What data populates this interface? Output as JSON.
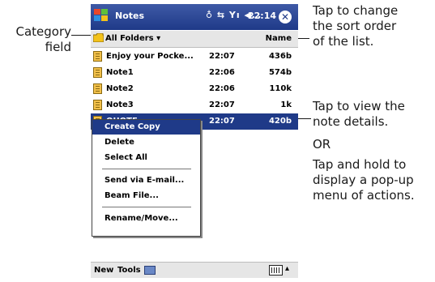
{
  "callouts": {
    "category": [
      "Category",
      "field"
    ],
    "sort": [
      "Tap to change",
      "the sort order",
      "of the list."
    ],
    "view": [
      "Tap to view the",
      "note details."
    ],
    "or": "OR",
    "hold": [
      "Tap and hold to",
      "display a pop-up",
      "menu of actions."
    ]
  },
  "titlebar": {
    "app_title": "Notes",
    "status_icons": "♁ ⇆ Yı ◀…",
    "time": "22:14",
    "close_icon": "✕"
  },
  "header": {
    "folder_label": "All Folders ▾",
    "sort_label": "Name"
  },
  "notes": [
    {
      "name": "Enjoy your Pocke...",
      "time": "22:07",
      "size": "436b"
    },
    {
      "name": "Note1",
      "time": "22:06",
      "size": "574b"
    },
    {
      "name": "Note2",
      "time": "22:06",
      "size": "110k"
    },
    {
      "name": "Note3",
      "time": "22:07",
      "size": "1k"
    },
    {
      "name": "QUOTE",
      "time": "22:07",
      "size": "420b"
    }
  ],
  "context_menu": {
    "items": [
      "Create Copy",
      "Delete",
      "Select All",
      "Send via E-mail...",
      "Beam File...",
      "Rename/Move..."
    ]
  },
  "bottombar": {
    "new_label": "New",
    "tools_label": "Tools",
    "arrow": "▴"
  },
  "colors": {
    "title_bg": "#1f3a88",
    "selection": "#1f3a88",
    "bar_bg": "#e6e6e6"
  }
}
